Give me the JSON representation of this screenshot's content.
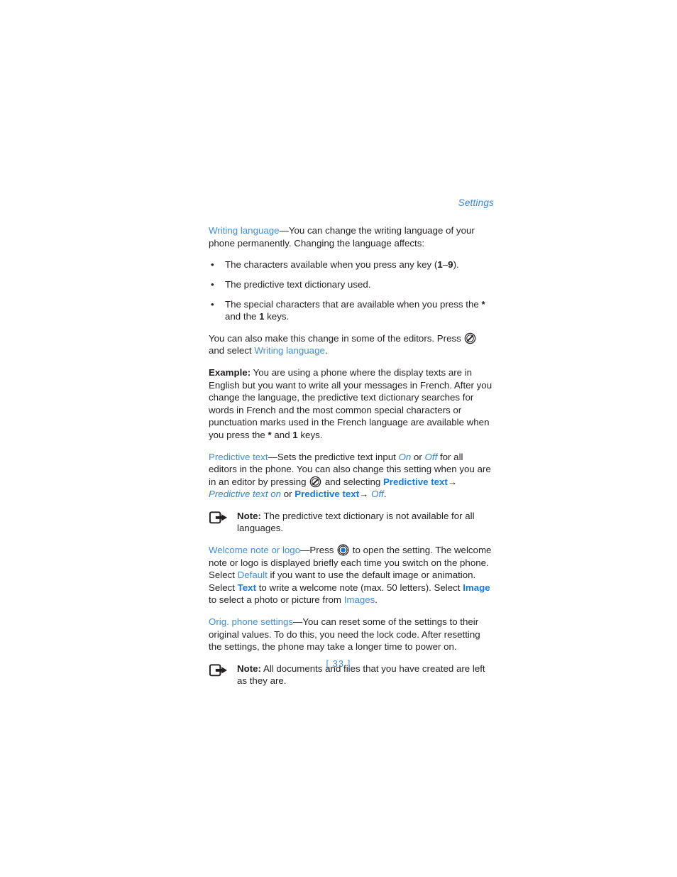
{
  "page": {
    "running_head": "Settings",
    "page_number": "[ 33 ]",
    "accent_link": "#3d8ede",
    "accent_bold": "#1479e4",
    "text_color": "#231f20"
  },
  "sections": {
    "writing_language": {
      "term": "Writing language",
      "dash": "—",
      "body": "You can change the writing language of your phone permanently. Changing the language affects:",
      "bullets": [
        {
          "pre": "The characters available when you press any key (",
          "key_a": "1",
          "mid": "–",
          "key_b": "9",
          "post": ").",
          "plain": "The characters available when you press any key (1–9)."
        },
        {
          "plain": "The predictive text dictionary used."
        },
        {
          "pre": "The special characters that are available when you press the ",
          "key_a": "*",
          "mid": " and the ",
          "key_b": "1",
          "post": " keys.",
          "plain": "The special characters that are available when you press the * and the 1 keys."
        }
      ],
      "editors_pre": "You can also make this change in some of the editors. Press ",
      "editors_icon": "options-key-icon",
      "editors_mid": " and select ",
      "editors_link": "Writing language",
      "editors_post": "."
    },
    "example": {
      "label": "Example:",
      "body_pre": " You are using a phone where the display texts are in English but you want to write all your messages in French. After you change the language, the predictive text dictionary searches for words in French and the most common special characters or punctuation marks used in the French language are available when you press the ",
      "key_a": "*",
      "body_mid": " and ",
      "key_b": "1",
      "body_post": " keys."
    },
    "predictive_text": {
      "term": "Predictive text",
      "dash": "—",
      "part1": "Sets the predictive text input ",
      "value_on": "On",
      "part2": " or ",
      "value_off": "Off",
      "part3": " for all editors in the phone. You can also change this setting when you are in an editor by pressing ",
      "icon": "options-key-icon",
      "part4": " and selecting ",
      "menu1": "Predictive text",
      "arrow1": "→",
      "menu1_value": "Predictive text on",
      "part5": " or ",
      "menu2": "Predictive text",
      "arrow2": "→",
      "menu2_value": "Off",
      "part6": "."
    },
    "note1": {
      "icon": "note-arrow-icon",
      "label": "Note:",
      "body": " The predictive text dictionary is not available for all languages."
    },
    "welcome_note": {
      "term": "Welcome note or logo",
      "dash": "—",
      "part1": "Press ",
      "icon": "navi-key-icon",
      "part2": " to open the setting. The welcome note or logo is displayed briefly each time you switch on the phone. Select ",
      "opt_default": "Default",
      "part3": " if you want to use the default image or animation. Select ",
      "opt_text": "Text",
      "part4": " to write a welcome note (max. 50 letters). Select ",
      "opt_image": "Image",
      "part5": " to select a photo or picture from ",
      "opt_images": "Images",
      "part6": "."
    },
    "orig_phone_settings": {
      "term": "Orig. phone settings",
      "dash": "—",
      "body": "You can reset some of the settings to their original values. To do this, you need the lock code. After resetting the settings, the phone may take a longer time to power on."
    },
    "note2": {
      "icon": "note-arrow-icon",
      "label": "Note:",
      "body": " All documents and files that you have created are left as they are."
    }
  }
}
